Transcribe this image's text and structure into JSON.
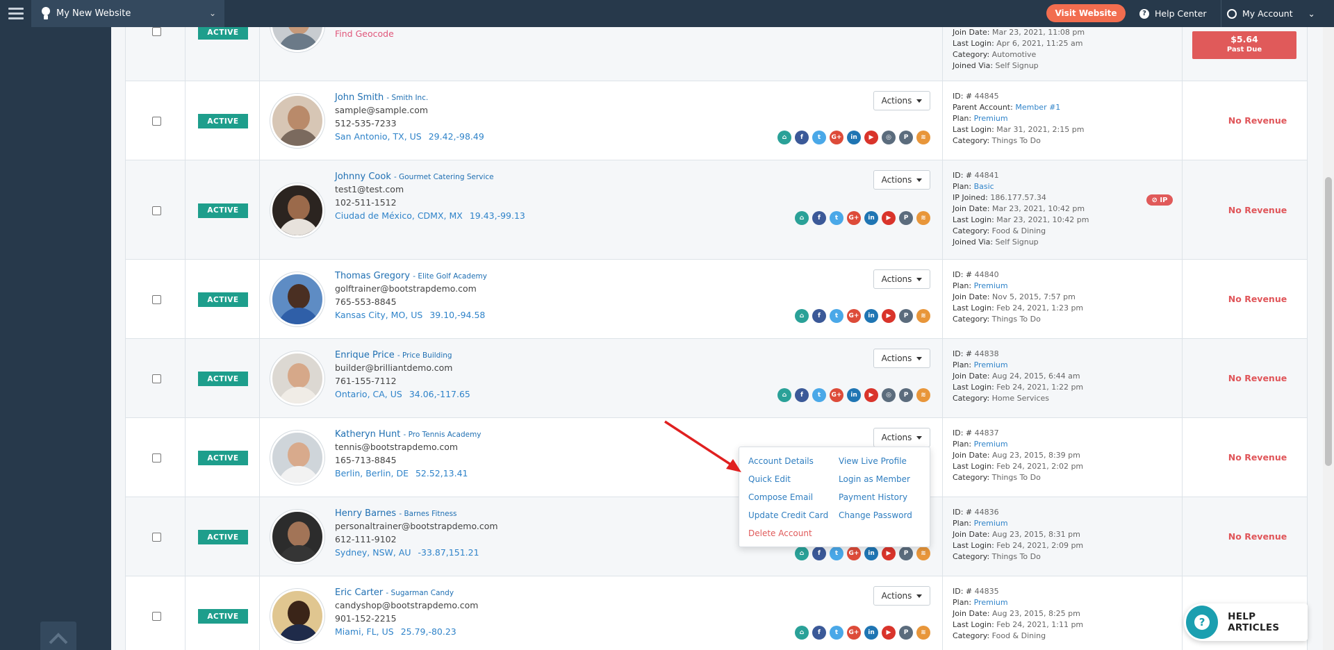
{
  "topbar": {
    "site_name": "My New Website",
    "visit_label": "Visit Website",
    "help_label": "Help Center",
    "account_label": "My Account"
  },
  "status_label": "ACTIVE",
  "actions_label": "Actions",
  "revenue_none": "No Revenue",
  "first_row": {
    "find_geocode": "Find Geocode",
    "meta": [
      {
        "label": "Join Date:",
        "value": "Mar 23, 2021, 11:08 pm"
      },
      {
        "label": "Last Login:",
        "value": "Apr 6, 2021, 11:25 am"
      },
      {
        "label": "Category:",
        "value": "Automotive"
      },
      {
        "label": "Joined Via:",
        "value": "Self Signup"
      }
    ],
    "past_due_amount": "$5.64",
    "past_due_label": "Past Due"
  },
  "members": [
    {
      "name": "John Smith",
      "company": "- Smith Inc.",
      "email": "sample@sample.com",
      "phone": "512-535-7233",
      "location": "San Antonio, TX, US",
      "coords": "29.42,-98.49",
      "meta": [
        {
          "label": "ID: #",
          "value": "44845"
        },
        {
          "label": "Parent Account:",
          "value": "Member #1",
          "link": true
        },
        {
          "label": "Plan:",
          "value": "Premium",
          "link": true
        },
        {
          "label": "Last Login:",
          "value": "Mar 31, 2021, 2:15 pm"
        },
        {
          "label": "Category:",
          "value": "Things To Do"
        }
      ]
    },
    {
      "name": "Johnny Cook",
      "company": "- Gourmet Catering Service",
      "email": "test1@test.com",
      "phone": "102-511-1512",
      "location": "Ciudad de México, CDMX, MX",
      "coords": "19.43,-99.13",
      "ip_badge": "IP",
      "meta": [
        {
          "label": "ID: #",
          "value": "44841"
        },
        {
          "label": "Plan:",
          "value": "Basic",
          "link": true
        },
        {
          "label": "IP Joined:",
          "value": "186.177.57.34"
        },
        {
          "label": "Join Date:",
          "value": "Mar 23, 2021, 10:42 pm"
        },
        {
          "label": "Last Login:",
          "value": "Mar 23, 2021, 10:42 pm"
        },
        {
          "label": "Category:",
          "value": "Food & Dining"
        },
        {
          "label": "Joined Via:",
          "value": "Self Signup"
        }
      ]
    },
    {
      "name": "Thomas Gregory",
      "company": "- Elite Golf Academy",
      "email": "golftrainer@bootstrapdemo.com",
      "phone": "765-553-8845",
      "location": "Kansas City, MO, US",
      "coords": "39.10,-94.58",
      "meta": [
        {
          "label": "ID: #",
          "value": "44840"
        },
        {
          "label": "Plan:",
          "value": "Premium",
          "link": true
        },
        {
          "label": "Join Date:",
          "value": "Nov 5, 2015, 7:57 pm"
        },
        {
          "label": "Last Login:",
          "value": "Feb 24, 2021, 1:23 pm"
        },
        {
          "label": "Category:",
          "value": "Things To Do"
        }
      ]
    },
    {
      "name": "Enrique Price",
      "company": "- Price Building",
      "email": "builder@brilliantdemo.com",
      "phone": "761-155-7112",
      "location": "Ontario, CA, US",
      "coords": "34.06,-117.65",
      "meta": [
        {
          "label": "ID: #",
          "value": "44838"
        },
        {
          "label": "Plan:",
          "value": "Premium",
          "link": true
        },
        {
          "label": "Join Date:",
          "value": "Aug 24, 2015, 6:44 am"
        },
        {
          "label": "Last Login:",
          "value": "Feb 24, 2021, 1:22 pm"
        },
        {
          "label": "Category:",
          "value": "Home Services"
        }
      ]
    },
    {
      "name": "Katheryn Hunt",
      "company": "- Pro Tennis Academy",
      "email": "tennis@bootstrapdemo.com",
      "phone": "165-713-8845",
      "location": "Berlin, Berlin, DE",
      "coords": "52.52,13.41",
      "meta": [
        {
          "label": "ID: #",
          "value": "44837"
        },
        {
          "label": "Plan:",
          "value": "Premium",
          "link": true
        },
        {
          "label": "Join Date:",
          "value": "Aug 23, 2015, 8:39 pm"
        },
        {
          "label": "Last Login:",
          "value": "Feb 24, 2021, 2:02 pm"
        },
        {
          "label": "Category:",
          "value": "Things To Do"
        }
      ]
    },
    {
      "name": "Henry Barnes",
      "company": "- Barnes Fitness",
      "email": "personaltrainer@bootstrapdemo.com",
      "phone": "612-111-9102",
      "location": "Sydney, NSW, AU",
      "coords": "-33.87,151.21",
      "meta": [
        {
          "label": "ID: #",
          "value": "44836"
        },
        {
          "label": "Plan:",
          "value": "Premium",
          "link": true
        },
        {
          "label": "Join Date:",
          "value": "Aug 23, 2015, 8:31 pm"
        },
        {
          "label": "Last Login:",
          "value": "Feb 24, 2021, 2:09 pm"
        },
        {
          "label": "Category:",
          "value": "Things To Do"
        }
      ]
    },
    {
      "name": "Eric Carter",
      "company": "- Sugarman Candy",
      "email": "candyshop@bootstrapdemo.com",
      "phone": "901-152-2215",
      "location": "Miami, FL, US",
      "coords": "25.79,-80.23",
      "meta": [
        {
          "label": "ID: #",
          "value": "44835"
        },
        {
          "label": "Plan:",
          "value": "Premium",
          "link": true
        },
        {
          "label": "Join Date:",
          "value": "Aug 23, 2015, 8:25 pm"
        },
        {
          "label": "Last Login:",
          "value": "Feb 24, 2021, 1:11 pm"
        },
        {
          "label": "Category:",
          "value": "Food & Dining"
        }
      ]
    }
  ],
  "dropdown": {
    "account_details": "Account Details",
    "view_live_profile": "View Live Profile",
    "quick_edit": "Quick Edit",
    "login_as_member": "Login as Member",
    "compose_email": "Compose Email",
    "payment_history": "Payment History",
    "update_credit_card": "Update Credit Card",
    "change_password": "Change Password",
    "delete_account": "Delete Account"
  },
  "help_articles": {
    "label": "HELP ARTICLES",
    "icon": "?"
  },
  "colors": {
    "topbar": "#27394b",
    "active_badge": "#1e9e8c",
    "link": "#2f83c9",
    "danger": "#e05a5a",
    "visit": "#f26d4f"
  }
}
